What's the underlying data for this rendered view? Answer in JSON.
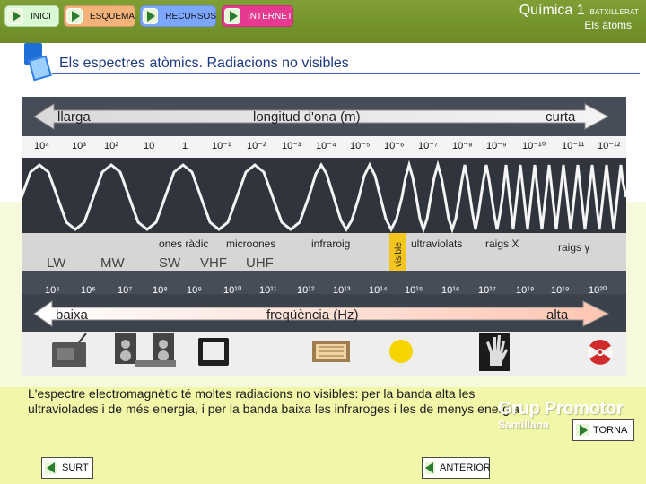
{
  "nav": {
    "inici": "INICI",
    "esquema": "ESQUEMA",
    "recursos": "RECURSOS",
    "internet": "INTERNET"
  },
  "header": {
    "title": "Química 1",
    "subtitle": "BATXILLERAT",
    "topic": "Els àtoms"
  },
  "section": {
    "title": "Els espectres atòmics. Radiacions no visibles"
  },
  "spectrum": {
    "arrow_top_left": "llarga",
    "arrow_top_center": "longitud d'ona (m)",
    "arrow_top_right": "curta",
    "wavelengths": [
      "10⁴",
      "10³",
      "10²",
      "10",
      "1",
      "10⁻¹",
      "10⁻²",
      "10⁻³",
      "10⁻⁴",
      "10⁻⁵",
      "10⁻⁶",
      "10⁻⁷",
      "10⁻⁸",
      "10⁻⁹",
      "10⁻¹⁰",
      "10⁻¹¹",
      "10⁻¹²"
    ],
    "bands_upper": [
      "ones ràdic",
      "microones",
      "infraroig",
      "visible",
      "ultraviolats",
      "raigs X",
      "raigs γ"
    ],
    "bands_lower": [
      "LW",
      "MW",
      "SW",
      "VHF",
      "UHF"
    ],
    "frequencies": [
      "10⁵",
      "10⁶",
      "10⁷",
      "10⁸",
      "10⁹",
      "10¹⁰",
      "10¹¹",
      "10¹²",
      "10¹³",
      "10¹⁴",
      "10¹⁵",
      "10¹⁶",
      "10¹⁷",
      "10¹⁸",
      "10¹⁹",
      "10²⁰"
    ],
    "arrow_bottom_left": "baixa",
    "arrow_bottom_center": "freqüència (Hz)",
    "arrow_bottom_right": "alta"
  },
  "description": "L'espectre electromagnètic té moltes radiacions no visibles: per la banda alta les ultraviolades i de més energia, i per la banda baixa les infraroges i les de menys energia.",
  "logo": {
    "brand": "Grup Promotor",
    "sub": "Santillana"
  },
  "buttons": {
    "torna": "TORNA",
    "surt": "SURT",
    "anterior": "ANTERIOR"
  },
  "colors": {
    "header_green": "#6c8b27",
    "title_blue": "#1d3a86",
    "nav_inici": "#d9fbd3",
    "nav_esquema": "#f2b27a",
    "nav_recursos": "#7da7ff",
    "nav_internet": "#e53a8f"
  }
}
